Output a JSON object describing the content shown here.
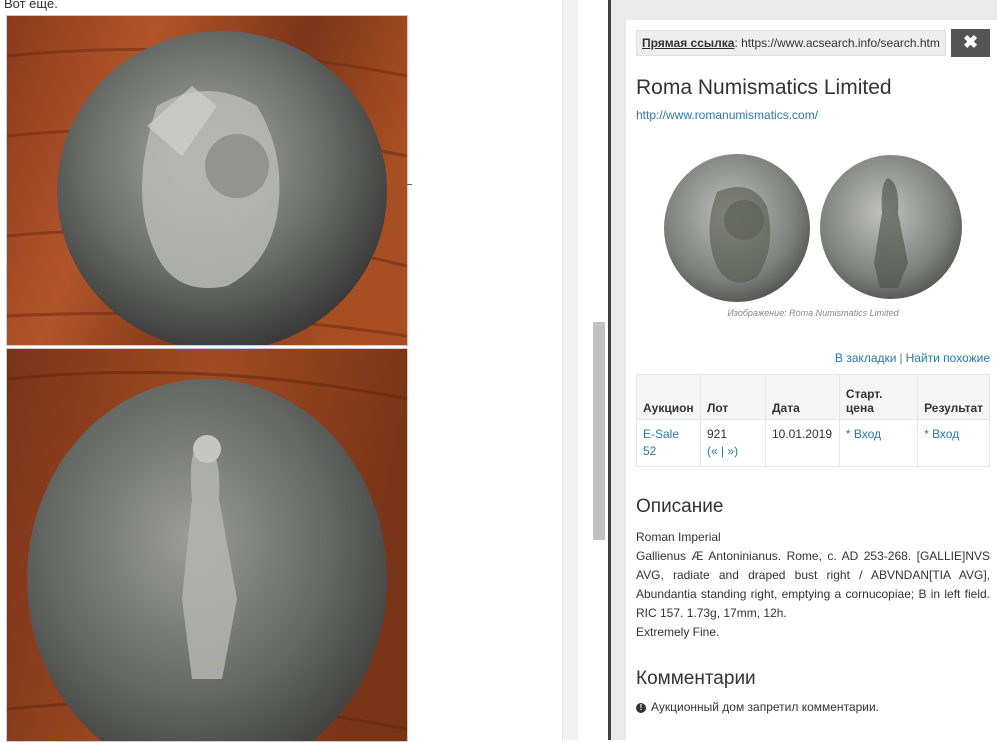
{
  "left": {
    "caption": "Вот еще."
  },
  "panel": {
    "link_label": "Прямая ссылка",
    "link_sep": ":",
    "link_url": "https://www.acsearch.info/search.htm",
    "close_glyph": "✖",
    "dealer_name": "Roma Numismatics Limited",
    "dealer_url": "http://www.romanumismatics.com/",
    "image_credit": "Изображение: Roma Numismatics Limited",
    "actions": {
      "bookmarks": "В закладки",
      "separator": "|",
      "find_similar": "Найти похожие"
    },
    "table": {
      "headers": [
        "Аукцион",
        "Лот",
        "Дата",
        "Старт. цена",
        "Результат"
      ],
      "row": {
        "auction": "E-Sale 52",
        "lot": "921",
        "lot_nav": "(« | »)",
        "date": "10.01.2019",
        "start_price": "* Вход",
        "result": "* Вход"
      }
    },
    "description_title": "Описание",
    "description_lines": [
      "Roman Imperial",
      "Gallienus Æ Antoninianus. Rome, c. AD 253-268. [GALLIE]NVS AVG, radiate and draped bust right / ABVNDAN[TIA AVG], Abundantia standing right, emptying a cornucopiae; B in left field. RIC 157. 1.73g, 17mm, 12h.",
      "Extremely Fine."
    ],
    "comments_title": "Комментарии",
    "comments_note": "Аукционный дом запретил комментарии."
  },
  "colors": {
    "link": "#2a78b5",
    "close_bg": "#555555",
    "separator": "#404040"
  }
}
